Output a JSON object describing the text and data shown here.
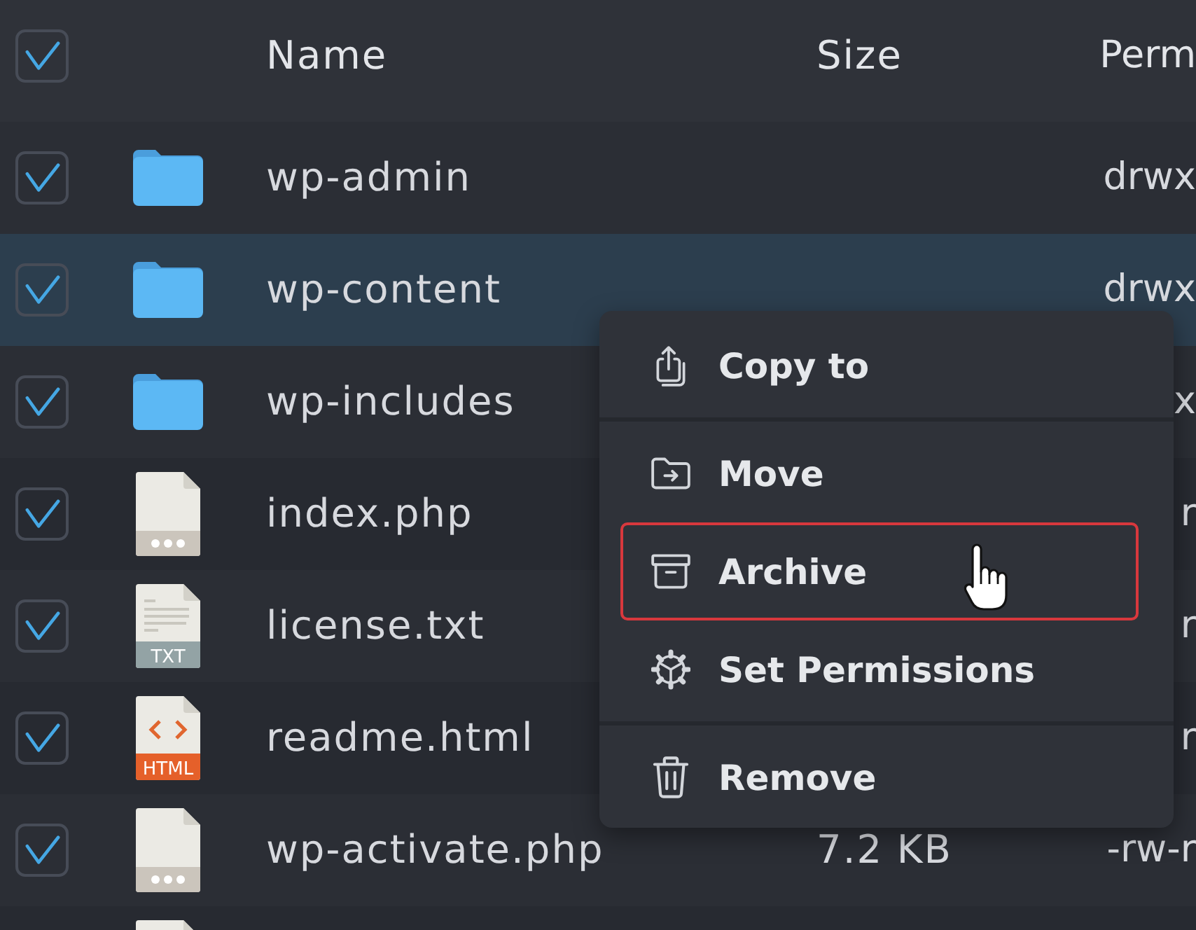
{
  "table": {
    "select_all": {
      "checked": true
    },
    "columns": [
      "Name",
      "Size",
      "Perm"
    ],
    "rows": [
      {
        "kind": "folder",
        "name": "wp-admin",
        "perms": "drwx",
        "checked": true,
        "selected": false
      },
      {
        "kind": "folder",
        "name": "wp-content",
        "perms": "drwx",
        "checked": true,
        "selected": true
      },
      {
        "kind": "folder",
        "name": "wp-includes",
        "perms": "x",
        "checked": true,
        "selected": false
      },
      {
        "kind": "file",
        "name": "index.php",
        "perms": "r",
        "checked": true,
        "selected": false
      },
      {
        "kind": "text",
        "label": "TXT",
        "name": "license.txt",
        "perms": "r",
        "checked": true,
        "selected": false
      },
      {
        "kind": "html",
        "label": "HTML",
        "name": "readme.html",
        "perms": "r",
        "checked": true,
        "selected": false
      },
      {
        "kind": "file",
        "name": "wp-activate.php",
        "size": "7.2 KB",
        "perms": "-rw-r",
        "checked": true,
        "selected": false
      },
      {
        "kind": "file"
      }
    ]
  },
  "context_menu": {
    "groups": [
      [
        {
          "kind": "copy",
          "label": "Copy to",
          "highlighted": false
        }
      ],
      [
        {
          "kind": "move",
          "label": "Move",
          "highlighted": false
        },
        {
          "kind": "archive",
          "label": "Archive",
          "highlighted": true
        },
        {
          "kind": "permissions",
          "label": "Set Permissions",
          "highlighted": false
        }
      ],
      [
        {
          "kind": "remove",
          "label": "Remove",
          "highlighted": false
        }
      ]
    ]
  }
}
